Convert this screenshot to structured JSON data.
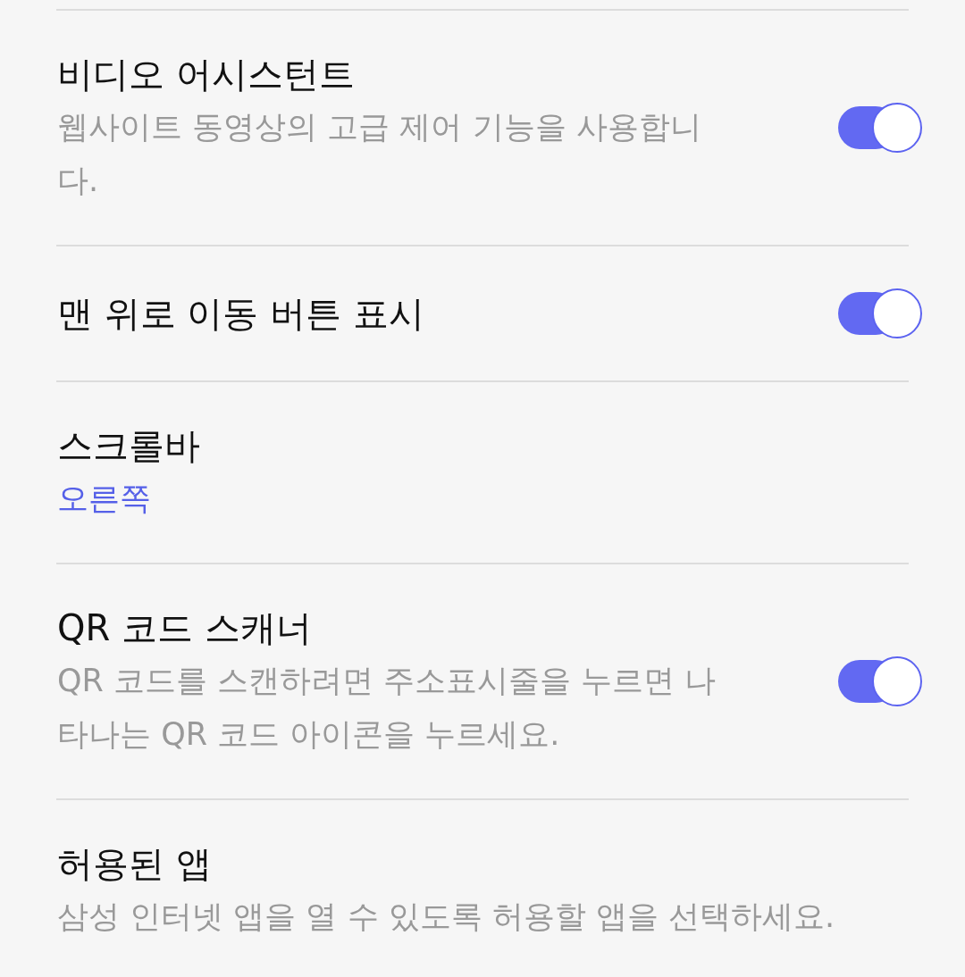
{
  "settings": [
    {
      "kind": "switch",
      "title": "비디오 어시스턴트",
      "subtitle": "웹사이트 동영상의 고급 제어 기능을 사용합니다.",
      "on": true
    },
    {
      "kind": "switch",
      "title": "맨 위로 이동 버튼 표시",
      "on": true
    },
    {
      "kind": "choice",
      "title": "스크롤바",
      "value": "오른쪽"
    },
    {
      "kind": "switch",
      "title": "QR 코드 스캐너",
      "subtitle": "QR 코드를 스캔하려면 주소표시줄을 누르면 나타나는 QR 코드 아이콘을 누르세요.",
      "on": true
    },
    {
      "kind": "link",
      "title": "허용된 앱",
      "subtitle": "삼성 인터넷 앱을 열 수 있도록 허용할 앱을 선택하세요."
    }
  ]
}
